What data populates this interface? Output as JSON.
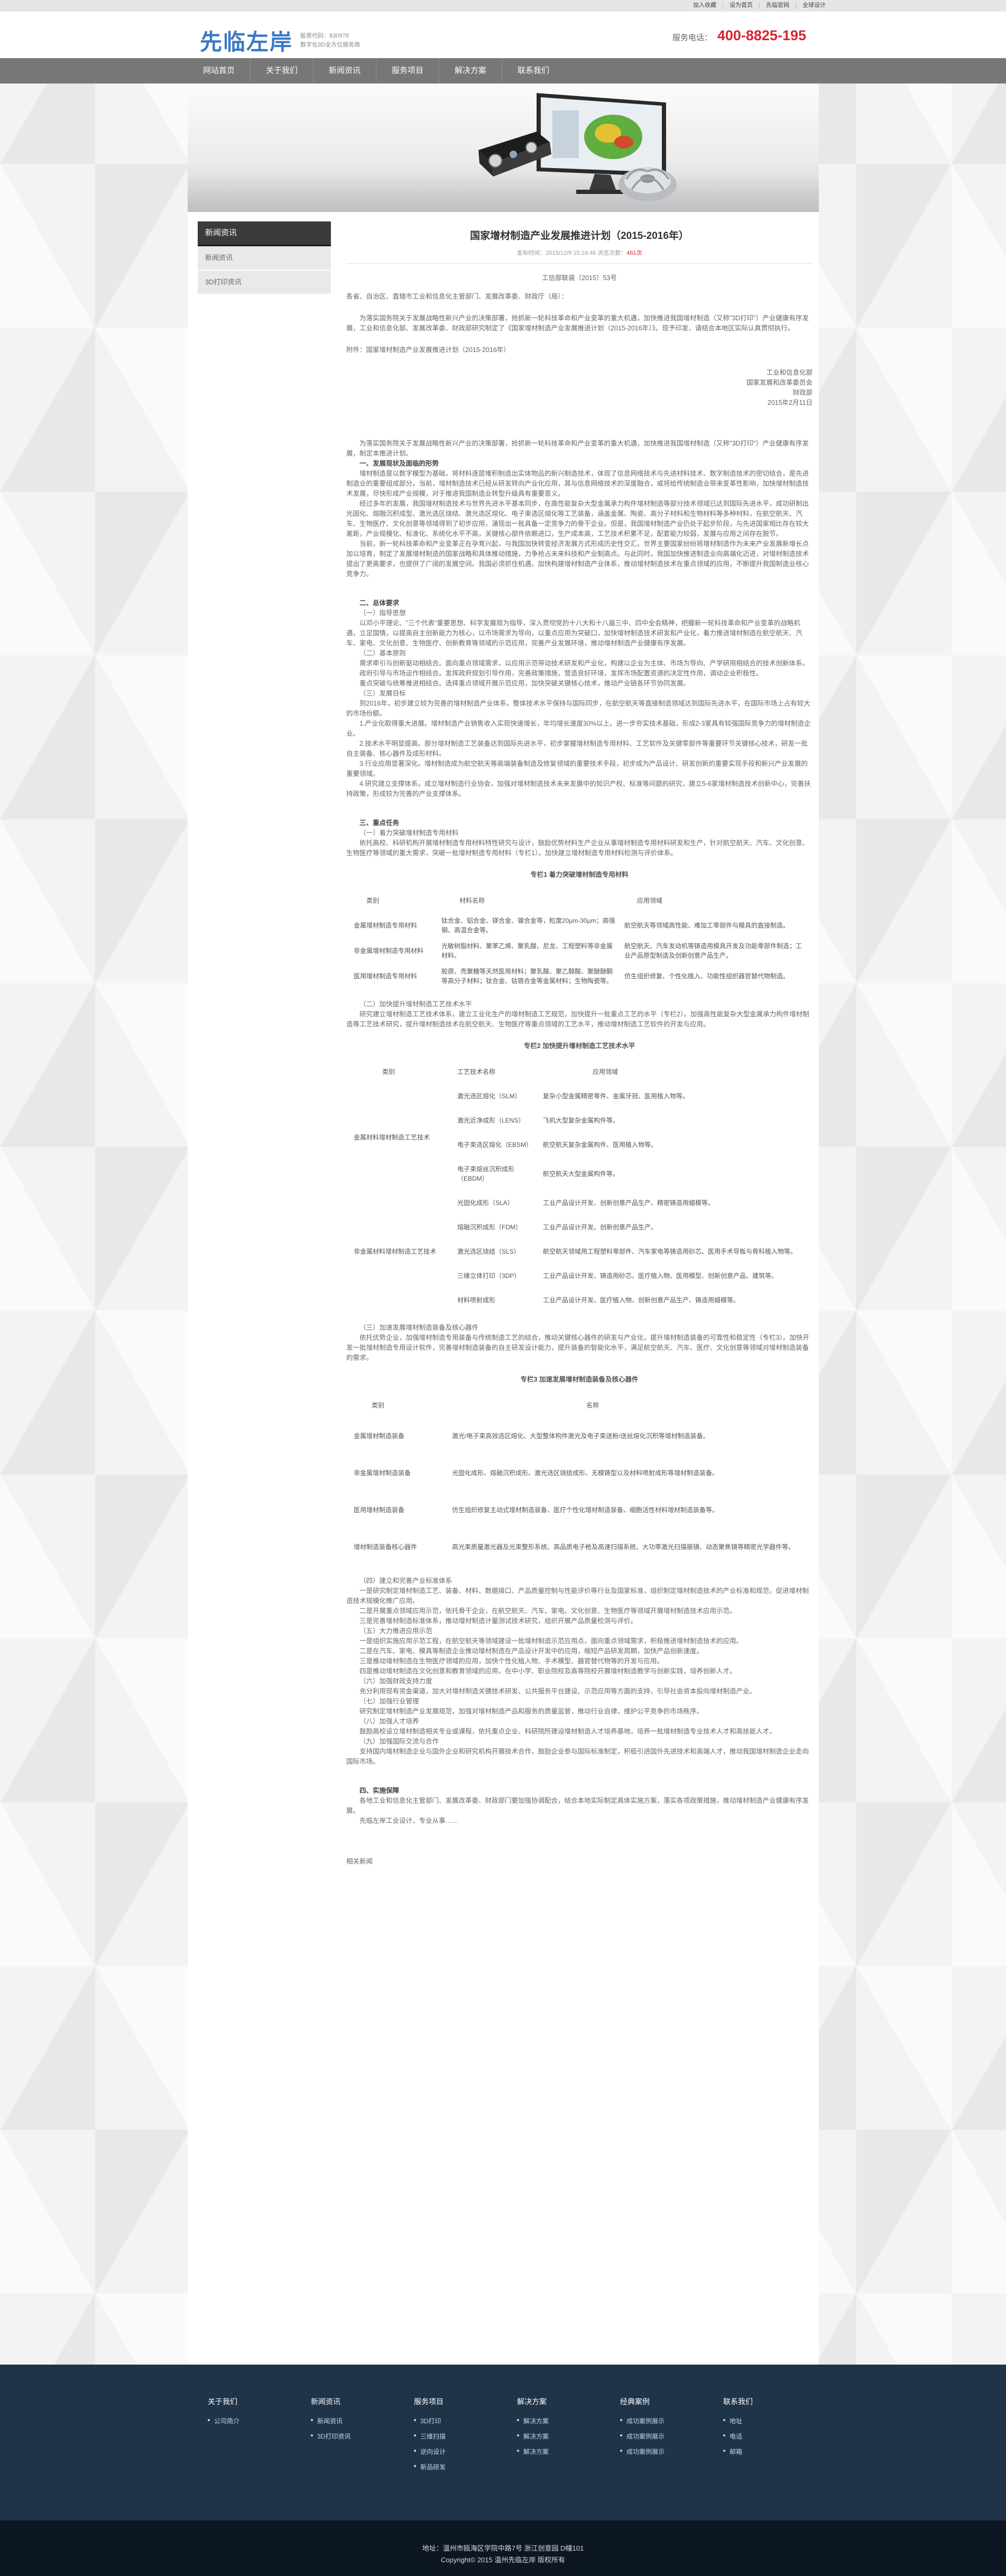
{
  "topbar": {
    "links": [
      "加入收藏",
      "设为首页",
      "先临官网",
      "全球设计"
    ]
  },
  "header": {
    "logo_text": "先临左岸",
    "logo_sub_1": "股票代码：830978",
    "logo_sub_2": "数字化3D全方位服务商",
    "hotline_label": "服务电话：",
    "hotline_number": "400-8825-195"
  },
  "nav": [
    "网站首页",
    "关于我们",
    "新闻资讯",
    "服务项目",
    "解决方案",
    "联系我们"
  ],
  "sidebar": {
    "title": "新闻资讯",
    "items": [
      "新闻资讯",
      "3D打印资讯"
    ]
  },
  "article": {
    "title": "国家增材制造产业发展推进计划（2015-2016年）",
    "meta_prefix": "发布时间：2015/12/9 15:16:46 浏览次数：",
    "meta_views": "461次",
    "intro": [
      "工信部联装〔2015〕53号",
      "各省、自治区、直辖市工业和信息化主管部门、发展改革委、财政厅（局）：",
      "为落实国务院关于发展战略性新兴产业的决策部署，抢抓新一轮科技革命和产业变革的重大机遇，加快推进我国增材制造（又称\"3D打印\"）产业健康有序发展，工业和信息化部、发展改革委、财政部研究制定了《国家增材制造产业发展推进计划（2015-2016年）》。现予印发，请结合本地区实际认真贯彻执行。",
      "附件：国家增材制造产业发展推进计划（2015-2016年）"
    ],
    "signatures": [
      "工业和信息化部",
      "国家发展和改革委员会",
      "财政部",
      "2015年2月11日"
    ],
    "body_1": [
      "为落实国务院关于发展战略性新兴产业的决策部署，抢抓新一轮科技革命和产业变革的重大机遇，加快推进我国增材制造（又称\"3D打印\"）产业健康有序发展，制定本推进计划。",
      "一、发展现状及面临的形势",
      "增材制造是以数字模型为基础，将材料逐层堆积制造出实体物品的新兴制造技术，体现了信息网络技术与先进材料技术、数字制造技术的密切结合，是先进制造业的重要组成部分。当前，增材制造技术已经从研发转向产业化应用，其与信息网络技术的深度融合，或将给传统制造业带来变革性影响，加快增材制造技术发展，尽快形成产业规模，对于推进我国制造业转型升级具有重要意义。",
      "经过多年的发展，我国增材制造技术与世界先进水平基本同步，在高性能复杂大型金属承力构件增材制造等部分技术领域已达到国际先进水平，成功研制出光固化、熔融沉积成型、激光选区烧结、激光选区熔化、电子束选区熔化等工艺装备，涵盖金属、陶瓷、高分子材料和生物材料等多种材料，在航空航天、汽车、生物医疗、文化创意等领域得到了初步应用，涌现出一批具备一定竞争力的骨干企业。但是，我国增材制造产业仍处于起步阶段，与先进国家相比存在较大差距，产业规模化、标准化、系统化水平不高，关键核心部件依赖进口，生产成本高，工艺技术积累不足，配套能力较弱，发展与应用之间存在脱节。",
      "当前，新一轮科技革命和产业变革正在孕育兴起，与我国加快转变经济发展方式形成历史性交汇。世界主要国家纷纷将增材制造作为未来产业发展新增长点加以培育，制定了发展增材制造的国家战略和具体推动措施，力争抢占未来科技和产业制高点。与此同时，我国加快推进制造业向高端化迈进，对增材制造技术提出了更高要求，也提供了广阔的发展空间。我国必须抓住机遇，加快构建增材制造产业体系，推动增材制造技术在重点领域的应用，不断提升我国制造业核心竞争力。"
    ],
    "body_2": [
      "二、总体要求",
      "（一）指导思想",
      "以邓小平理论、\"三个代表\"重要思想、科学发展观为指导，深入贯彻党的十八大和十八届三中、四中全会精神，把握新一轮科技革命和产业变革的战略机遇，立足国情，以提高自主创新能力为核心，以市场需求为导向，以重点应用为突破口，加快增材制造技术研发和产业化，着力推进增材制造在航空航天、汽车、家电、文化创意、生物医疗、创新教育等领域的示范应用，完善产业发展环境，推动增材制造产业健康有序发展。",
      "（二）基本原则",
      "需求牵引与创新驱动相结合。面向重点领域需求，以应用示范带动技术研发和产业化，构建以企业为主体、市场为导向、产学研用相结合的技术创新体系。",
      "政府引导与市场运作相结合。发挥政府规划引导作用，完善政策措施，营造良好环境，发挥市场配置资源的决定性作用，调动企业积极性。",
      "重点突破与统筹推进相结合。选择重点领域开展示范应用，加快突破关键核心技术，推动产业链各环节协同发展。",
      "（三）发展目标",
      "到2016年，初步建立较为完善的增材制造产业体系，整体技术水平保持与国际同步，在航空航天等直接制造领域达到国际先进水平，在国际市场上占有较大的市场份额。",
      "1.产业化取得重大进展。增材制造产业销售收入实现快速增长，年均增长速度30%以上。进一步夯实技术基础，形成2-3家具有较强国际竞争力的增材制造企业。",
      "2.技术水平明显提高。部分增材制造工艺装备达到国际先进水平，初步掌握增材制造专用材料、工艺软件及关键零部件等重要环节关键核心技术，研发一批自主装备、核心器件及成形材料。",
      "3.行业应用显著深化。增材制造成为航空航天等高端装备制造及修复领域的重要技术手段，初步成为产品设计、研发创新的重要实现手段和新兴产业发展的重要领域。",
      "4.研究建立支撑体系。成立增材制造行业协会，加强对增材制造技术未来发展中的知识产权、标准等问题的研究，建立5-6家增材制造技术创新中心，完善扶持政策，形成较为完善的产业支撑体系。"
    ],
    "body_3": [
      "三、重点任务",
      "（一）着力突破增材制造专用材料",
      "依托高校、科研机构开展增材制造专用材料特性研究与设计，鼓励优势材料生产企业从事增材制造专用材料研发和生产，针对航空航天、汽车、文化创意、生物医疗等领域的重大需求，突破一批增材制造专用材料（专栏1）。加快建立增材制造专用材料检测与评价体系。"
    ],
    "table1": {
      "caption": "专栏1 着力突破增材制造专用材料",
      "headers": [
        "类别",
        "材料名称",
        "应用领域"
      ],
      "rows": [
        [
          "金属增材制造专用材料",
          "钛合金、铝合金、镁合金、镍合金等，粒度20μm-30μm；高强钢、高温合金等。",
          "航空航天等领域高性能、难加工零部件与模具的直接制造。"
        ],
        [
          "非金属增材制造专用材料",
          "光敏树脂材料、聚苯乙烯、聚乳酸、尼龙、工程塑料等非金属材料。",
          "航空航天、汽车发动机等铸造用模具开发及功能零部件制造；工业产品原型制造及创新创意产品生产。"
        ],
        [
          "医用增材制造专用材料",
          "胶原、壳聚糖等天然医用材料；聚乳酸、聚乙醇酸、聚醚醚酮等高分子材料；钛合金、钴铬合金等金属材料；生物陶瓷等。",
          "仿生组织修复、个性化植入、功能性组织器官替代物制造。"
        ]
      ]
    },
    "body_4": [
      "（二）加快提升增材制造工艺技术水平",
      "研究建立增材制造工艺技术体系，建立工业化生产的增材制造工艺规范，加快提升一批重点工艺的水平（专栏2）。加强高性能复杂大型金属承力构件增材制造等工艺技术研究，提升增材制造技术在航空航天、生物医疗等重点领域的工艺水平，推动增材制造工艺软件的开发与应用。"
    ],
    "table2": {
      "caption": "专栏2 加快提升增材制造工艺技术水平",
      "headers": [
        "类别",
        "工艺技术名称",
        "应用领域"
      ],
      "group1": "金属材料增材制造工艺技术",
      "group2": "非金属材料增材制造工艺技术",
      "rows": [
        [
          "激光选区熔化（SLM）",
          "复杂小型金属精密零件、金属牙冠、医用植入物等。"
        ],
        [
          "激光近净成形（LENS）",
          "飞机大型复杂金属构件等。"
        ],
        [
          "电子束选区熔化（EBSM）",
          "航空航天复杂金属构件、医用植入物等。"
        ],
        [
          "电子束熔丝沉积成形（EBDM）",
          "航空航天大型金属构件等。"
        ],
        [
          "光固化成形（SLA）",
          "工业产品设计开发、创新创意产品生产、精密铸造用蜡模等。"
        ],
        [
          "熔融沉积成形（FDM）",
          "工业产品设计开发、创新创意产品生产。"
        ],
        [
          "激光选区烧结（SLS）",
          "航空航天领域用工程塑料零部件、汽车家电等铸造用砂芯、医用手术导板与骨科植入物等。"
        ],
        [
          "三维立体打印（3DP）",
          "工业产品设计开发、铸造用砂芯、医疗植入物、医用模型、创新创意产品、建筑等。"
        ],
        [
          "材料喷射成形",
          "工业产品设计开发、医疗植入物、创新创意产品生产、铸造用蜡模等。"
        ]
      ]
    },
    "body_5": [
      "（三）加速发展增材制造装备及核心器件",
      "依托优势企业，加强增材制造专用装备与传统制造工艺的结合，推动关键核心器件的研发与产业化，提升增材制造装备的可靠性和稳定性（专栏3）。加快开发一批增材制造专用设计软件，完善增材制造装备的自主研发设计能力，提升装备的智能化水平，满足航空航天、汽车、医疗、文化创意等领域对增材制造装备的需求。"
    ],
    "table3": {
      "caption": "专栏3 加速发展增材制造装备及核心器件",
      "headers": [
        "类别",
        "名称"
      ],
      "rows": [
        [
          "金属增材制造装备",
          "激光/电子束高效选区熔化、大型整体构件激光及电子束送粉/送丝熔化沉积等增材制造装备。"
        ],
        [
          "非金属增材制造装备",
          "光固化成形、熔融沉积成形、激光选区烧结成形、无模铸型以及材料喷射成形等增材制造装备。"
        ],
        [
          "医用增材制造装备",
          "仿生组织修复主动式增材制造装备、医疗个性化增材制造装备、细胞活性材料增材制造装备等。"
        ],
        [
          "增材制造装备核心器件",
          "高光束质量激光器及光束整形系统、高品质电子枪及高速扫描系统、大功率激光扫描振镜、动态聚焦镜等精密光学器件等。"
        ]
      ]
    },
    "body_6": [
      "（四）建立和完善产业标准体系",
      "一是研究制定增材制造工艺、装备、材料、数据接口、产品质量控制与性能评价等行业及国家标准，组织制定增材制造技术的产业标准和规范，促进增材制造技术规模化推广应用。",
      "二是开展重点领域应用示范，依托骨干企业，在航空航天、汽车、家电、文化创意、生物医疗等领域开展增材制造技术应用示范。",
      "三是完善增材制造标准体系，推动增材制造计量测试技术研究，组织开展产品质量检测与评价。",
      "（五）大力推进应用示范",
      "一是组织实施应用示范工程，在航空航天等领域建设一批增材制造示范应用点，面向重点领域需求，积极推进增材制造技术的应用。",
      "二是在汽车、家电、模具等制造企业推动增材制造在产品设计开发中的应用，缩短产品研发周期，加快产品创新速度。",
      "三是推动增材制造在生物医疗领域的应用，加快个性化植入物、手术模型、器官替代物等的开发与应用。",
      "四是推动增材制造在文化创意和教育领域的应用，在中小学、职业院校及高等院校开展增材制造教学与创新实践，培养创新人才。",
      "（六）加强财政支持力度",
      "充分利用现有资金渠道，加大对增材制造关键技术研发、公共服务平台建设、示范应用等方面的支持，引导社会资本投向增材制造产业。",
      "（七）加强行业管理",
      "研究制定增材制造产业发展规范，加强对增材制造产品和服务的质量监管，推动行业自律，维护公平竞争的市场秩序。",
      "（八）加强人才培养",
      "鼓励高校设立增材制造相关专业或课程，依托重点企业、科研院所建设增材制造人才培养基地，培养一批增材制造专业技术人才和高技能人才。",
      "（九）加强国际交流与合作",
      "支持国内增材制造企业与国外企业和研究机构开展技术合作，鼓励企业参与国际标准制定，积极引进国外先进技术和高端人才，推动我国增材制造企业走向国际市场。"
    ],
    "body_7": [
      "四、实施保障",
      "各地工业和信息化主管部门、发展改革委、财政部门要加强协调配合，结合本地实际制定具体实施方案，落实各项政策措施，推动增材制造产业健康有序发展。",
      "先临左岸工业设计，专业从事……"
    ],
    "source_note": "相关新闻"
  },
  "footer": {
    "columns": [
      {
        "head": "关于我们",
        "links": [
          "公司简介"
        ]
      },
      {
        "head": "新闻资讯",
        "links": [
          "新闻资讯",
          "3D打印资讯"
        ]
      },
      {
        "head": "服务项目",
        "links": [
          "3D打印",
          "三维扫描",
          "逆向设计",
          "新品研发"
        ]
      },
      {
        "head": "解决方案",
        "links": [
          "解决方案",
          "解决方案",
          "解决方案"
        ]
      },
      {
        "head": "经典案例",
        "links": [
          "成功案例展示",
          "成功案例展示",
          "成功案例展示"
        ]
      },
      {
        "head": "联系我们",
        "links": [
          "地址",
          "电话",
          "邮箱"
        ]
      }
    ],
    "address": "地址：温州市瓯海区学院中路7号 浙江创意园 D幢101",
    "copyright": "Copyright© 2015 温州先临左岸 版权所有"
  }
}
